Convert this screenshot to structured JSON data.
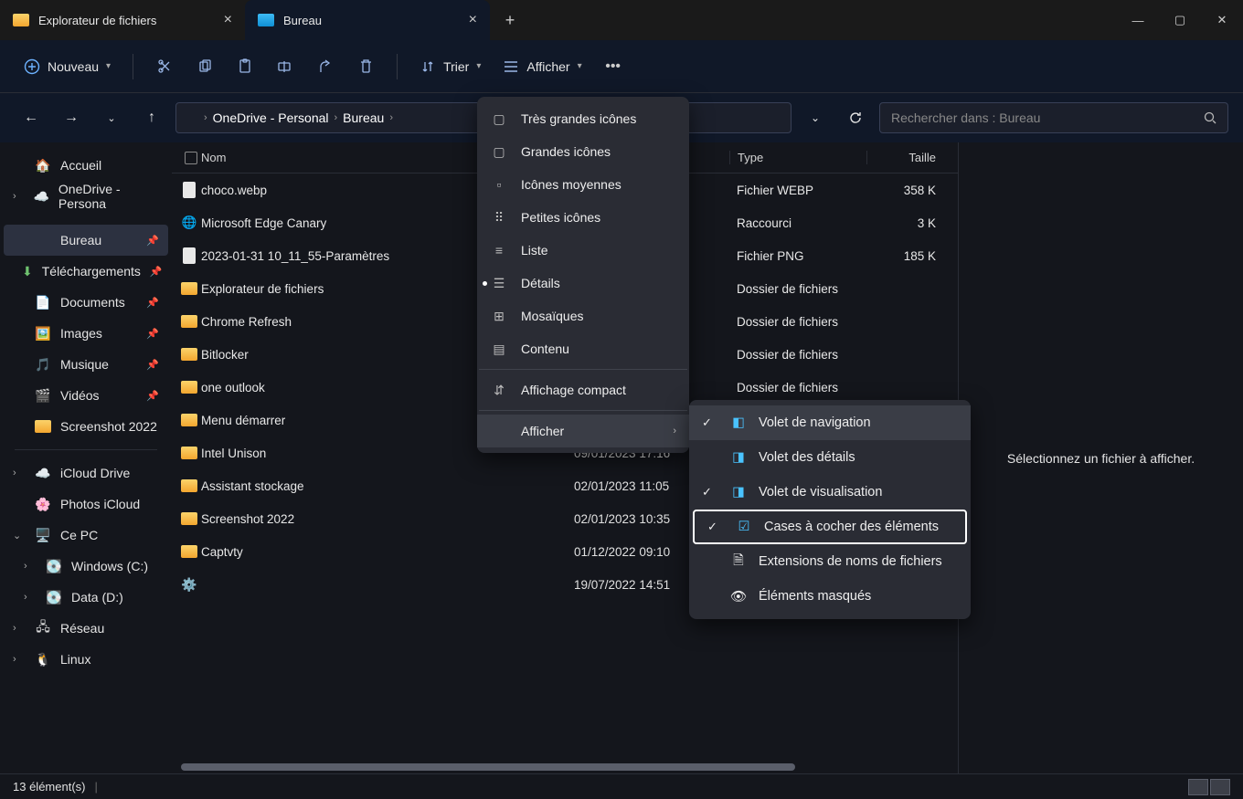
{
  "tabs": [
    {
      "label": "Explorateur de fichiers",
      "icon": "folder"
    },
    {
      "label": "Bureau",
      "icon": "desktop"
    }
  ],
  "toolbar": {
    "new_label": "Nouveau",
    "sort_label": "Trier",
    "view_label": "Afficher"
  },
  "breadcrumb": {
    "seg1": "OneDrive - Personal",
    "seg2": "Bureau"
  },
  "search": {
    "placeholder": "Rechercher dans : Bureau"
  },
  "columns": {
    "name": "Nom",
    "type": "Type",
    "size": "Taille"
  },
  "sidebar": {
    "home": "Accueil",
    "onedrive": "OneDrive - Persona",
    "desktop": "Bureau",
    "downloads": "Téléchargements",
    "documents": "Documents",
    "images": "Images",
    "music": "Musique",
    "videos": "Vidéos",
    "screenshot": "Screenshot 2022",
    "icloud_drive": "iCloud Drive",
    "icloud_photos": "Photos iCloud",
    "thispc": "Ce PC",
    "drive_c": "Windows (C:)",
    "drive_d": "Data (D:)",
    "network": "Réseau",
    "linux": "Linux"
  },
  "files": [
    {
      "name": "choco.webp",
      "date": "",
      "type": "Fichier WEBP",
      "size": "358 K",
      "icon": "file"
    },
    {
      "name": "Microsoft Edge Canary",
      "date": "",
      "type": "Raccourci",
      "size": "3 K",
      "icon": "edge"
    },
    {
      "name": "2023-01-31 10_11_55-Paramètres",
      "date": "",
      "type": "Fichier PNG",
      "size": "185 K",
      "icon": "file"
    },
    {
      "name": "Explorateur de fichiers",
      "date": "",
      "type": "Dossier de fichiers",
      "size": "",
      "icon": "folder"
    },
    {
      "name": "Chrome Refresh",
      "date": "",
      "type": "Dossier de fichiers",
      "size": "",
      "icon": "folder"
    },
    {
      "name": "Bitlocker",
      "date": "",
      "type": "Dossier de fichiers",
      "size": "",
      "icon": "folder"
    },
    {
      "name": "one outlook",
      "date": "",
      "type": "Dossier de fichiers",
      "size": "",
      "icon": "folder"
    },
    {
      "name": "Menu démarrer",
      "date": "",
      "type": "",
      "size": "",
      "icon": "folder"
    },
    {
      "name": "Intel Unison",
      "date": "09/01/2023 17:16",
      "type": "",
      "size": "",
      "icon": "folder"
    },
    {
      "name": "Assistant stockage",
      "date": "02/01/2023 11:05",
      "type": "",
      "size": "",
      "icon": "folder"
    },
    {
      "name": "Screenshot 2022",
      "date": "02/01/2023 10:35",
      "type": "",
      "size": "",
      "icon": "folder"
    },
    {
      "name": "Captvty",
      "date": "01/12/2022 09:10",
      "type": "",
      "size": "",
      "icon": "folder"
    },
    {
      "name": "",
      "date": "19/07/2022 14:51",
      "type": "",
      "size": "",
      "icon": "cpl"
    }
  ],
  "view_menu": {
    "xl_icons": "Très grandes icônes",
    "l_icons": "Grandes icônes",
    "m_icons": "Icônes moyennes",
    "s_icons": "Petites icônes",
    "list": "Liste",
    "details": "Détails",
    "tiles": "Mosaïques",
    "content": "Contenu",
    "compact": "Affichage compact",
    "show": "Afficher"
  },
  "show_menu": {
    "nav_pane": "Volet de navigation",
    "details_pane": "Volet des détails",
    "preview_pane": "Volet de visualisation",
    "checkboxes": "Cases à cocher des éléments",
    "extensions": "Extensions de noms de fichiers",
    "hidden": "Éléments masqués"
  },
  "details_pane": {
    "placeholder": "Sélectionnez un fichier à afficher."
  },
  "status": {
    "count": "13 élément(s)"
  }
}
